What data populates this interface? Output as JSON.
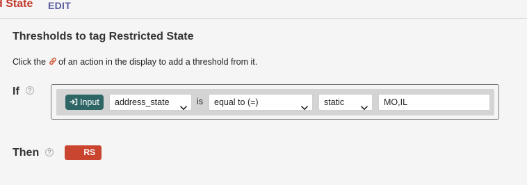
{
  "header": {
    "title": "d State",
    "edit_label": "EDIT"
  },
  "section": {
    "heading": "Thresholds to tag Restricted State",
    "instructions_before": "Click the",
    "instructions_after": "of an action in the display to add a threshold from it.",
    "link_icon": "link-icon"
  },
  "if_row": {
    "label": "If",
    "help_icon": "?",
    "input_button_label": "Input",
    "input_icon": "arrow-into-icon",
    "field_select": "address_state",
    "is_label": "is",
    "operator_select": "equal to (=)",
    "value_type_select": "static",
    "value": "MO,IL"
  },
  "then_row": {
    "label": "Then",
    "help_icon": "?",
    "tag_label": "RS"
  },
  "colors": {
    "title_red": "#c0392b",
    "edit_purple": "#5a5aa0",
    "input_teal": "#2e6565",
    "tag_red": "#c9452f",
    "link_orange": "#d05a3a"
  }
}
